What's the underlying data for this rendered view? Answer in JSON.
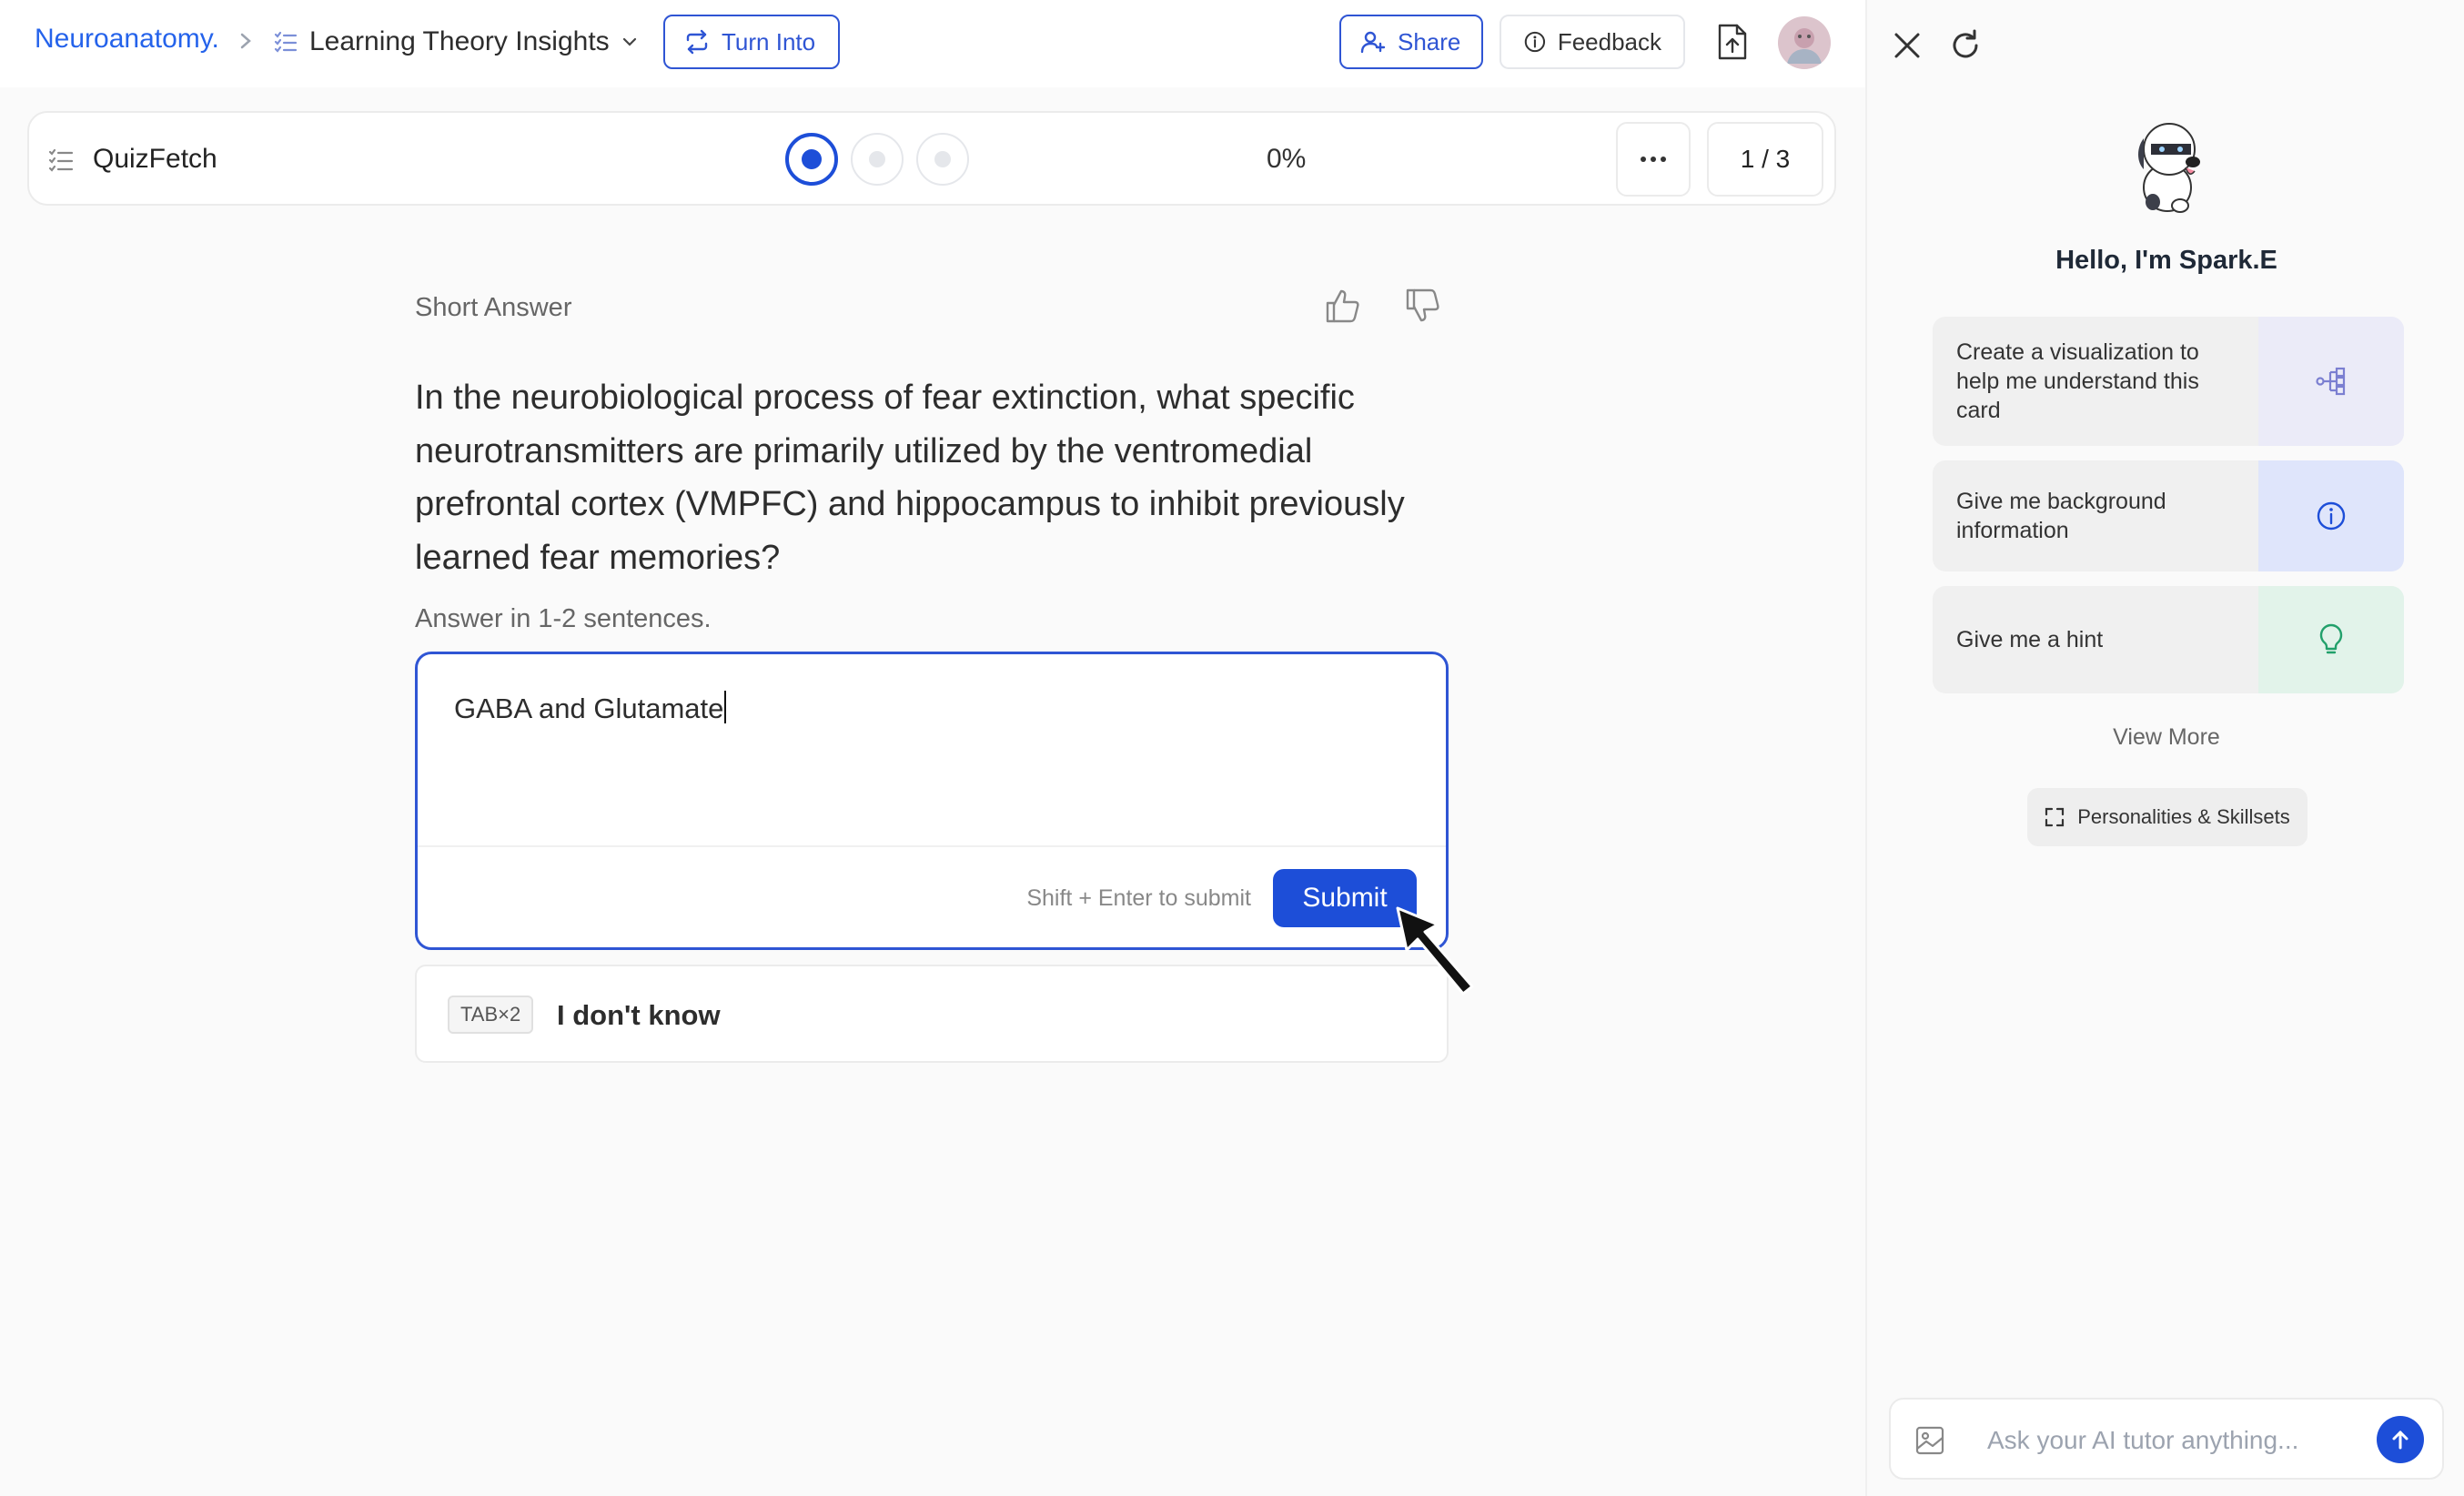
{
  "header": {
    "breadcrumb_root": "Neuroanatomy.",
    "page_title": "Learning Theory Insights",
    "turn_into_label": "Turn Into",
    "share_label": "Share",
    "feedback_label": "Feedback"
  },
  "quiz": {
    "title": "QuizFetch",
    "progress": "0%",
    "current_index": 1,
    "total": 3,
    "counter": "1 / 3"
  },
  "question": {
    "type": "Short Answer",
    "text": "In the neurobiological process of fear extinction, what specific neurotransmitters are primarily utilized by the ventromedial prefrontal cortex (VMPFC) and hippocampus to inhibit previously learned fear memories?",
    "instructions": "Answer in 1-2 sentences.",
    "answer_value": "GABA and Glutamate",
    "submit_hint": "Shift + Enter to submit",
    "submit_label": "Submit",
    "idk_shortcut": "TAB×2",
    "idk_label": "I don't know"
  },
  "assistant": {
    "greeting": "Hello, I'm Spark.E",
    "suggestions": [
      {
        "label": "Create a visualization to help me understand this card",
        "icon": "diagram-icon",
        "accent": "#7b7fd1",
        "bg": "#ebebf8"
      },
      {
        "label": "Give me background information",
        "icon": "info-icon",
        "accent": "#1d4ed8",
        "bg": "#dfe5fb"
      },
      {
        "label": "Give me a hint",
        "icon": "lightbulb-icon",
        "accent": "#22a06b",
        "bg": "#e2f3ea"
      }
    ],
    "view_more": "View More",
    "personalities_label": "Personalities & Skillsets",
    "input_placeholder": "Ask your AI tutor anything..."
  },
  "colors": {
    "primary": "#1d4ed8",
    "link": "#2563eb",
    "border_accent": "#2f55d4"
  }
}
